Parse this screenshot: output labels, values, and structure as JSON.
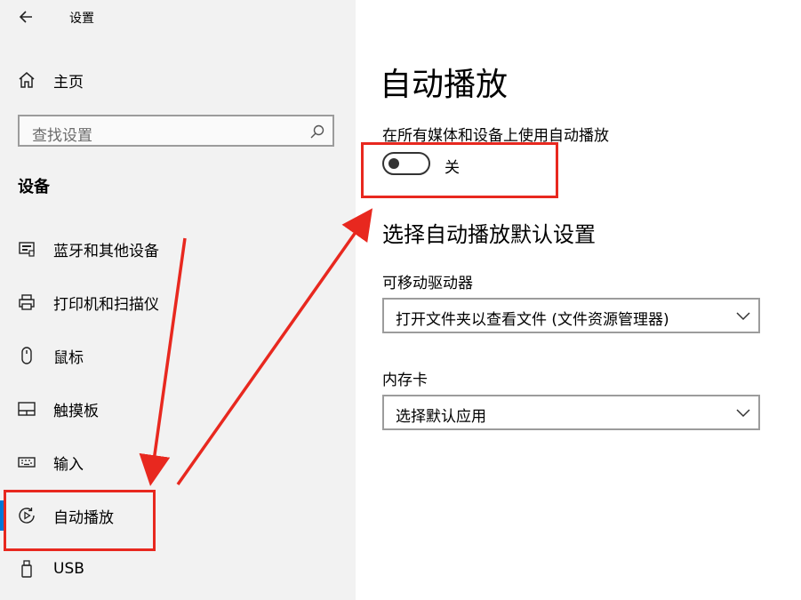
{
  "header": {
    "app_title": "设置"
  },
  "sidebar": {
    "home_label": "主页",
    "search_placeholder": "查找设置",
    "section_title": "设备",
    "items": [
      {
        "label": "蓝牙和其他设备",
        "icon": "bluetooth-devices-icon"
      },
      {
        "label": "打印机和扫描仪",
        "icon": "printer-icon"
      },
      {
        "label": "鼠标",
        "icon": "mouse-icon"
      },
      {
        "label": "触摸板",
        "icon": "touchpad-icon"
      },
      {
        "label": "输入",
        "icon": "keyboard-icon"
      },
      {
        "label": "自动播放",
        "icon": "autoplay-icon",
        "selected": true
      },
      {
        "label": "USB",
        "icon": "usb-icon"
      }
    ]
  },
  "main": {
    "title": "自动播放",
    "toggle_label": "在所有媒体和设备上使用自动播放",
    "toggle_state_text": "关",
    "toggle_on": false,
    "defaults_title": "选择自动播放默认设置",
    "removable_drive_label": "可移动驱动器",
    "removable_drive_value": "打开文件夹以查看文件 (文件资源管理器)",
    "memory_card_label": "内存卡",
    "memory_card_value": "选择默认应用"
  },
  "colors": {
    "accent": "#0078d7",
    "annotation_red": "#e8281f",
    "sidebar_bg": "#f2f2f2"
  }
}
